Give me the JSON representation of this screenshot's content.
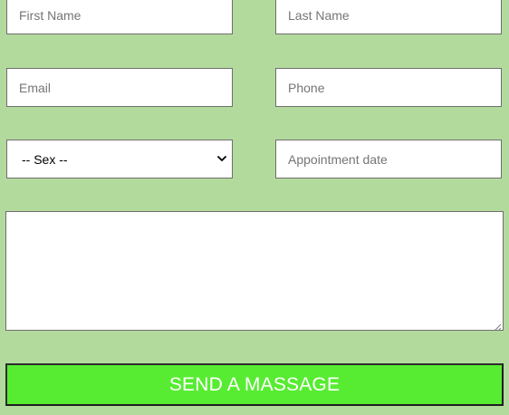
{
  "form": {
    "first_name": {
      "placeholder": "First Name",
      "value": ""
    },
    "last_name": {
      "placeholder": "Last Name",
      "value": ""
    },
    "email": {
      "placeholder": "Email",
      "value": ""
    },
    "phone": {
      "placeholder": "Phone",
      "value": ""
    },
    "sex": {
      "selected": "-- Sex --"
    },
    "appointment_date": {
      "placeholder": "Appointment date",
      "value": ""
    },
    "message": {
      "value": ""
    },
    "submit_label": "SEND A MASSAGE"
  },
  "colors": {
    "background": "#b3da9d",
    "button": "#57ec32",
    "button_text": "#ffffff",
    "placeholder_text": "#757575"
  },
  "icons": {
    "select_arrow": "chevron-down-icon",
    "textarea_resize": "resize-handle-icon"
  }
}
